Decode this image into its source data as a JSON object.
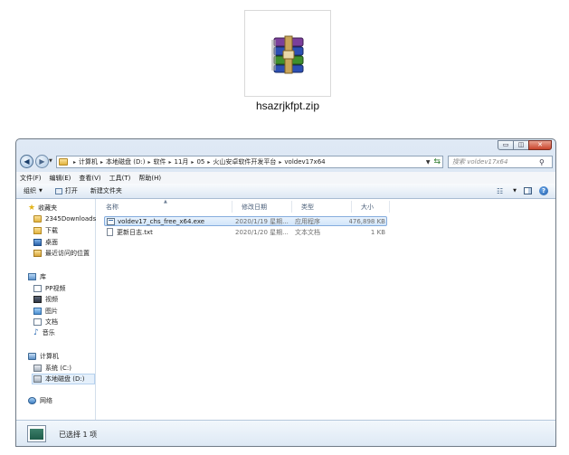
{
  "zip_file": {
    "name": "hsazrjkfpt.zip",
    "icon": "winrar-archive-icon"
  },
  "window": {
    "caption_buttons": {
      "minimize": "▭",
      "maximize": "◫",
      "close": "✕"
    },
    "breadcrumb": [
      "计算机",
      "本地磁盘 (D:)",
      "软件",
      "11月",
      "05",
      "火山安卓软件开发平台",
      "voldev17x64"
    ],
    "search_placeholder": "搜索 voldev17x64",
    "menu": [
      "文件(F)",
      "编辑(E)",
      "查看(V)",
      "工具(T)",
      "帮助(H)"
    ],
    "toolbar": {
      "organize": "组织",
      "open": "打开",
      "new_folder": "新建文件夹"
    },
    "nav": {
      "favorites": {
        "label": "收藏夹",
        "items": [
          "2345Downloads",
          "下载",
          "桌面",
          "最近访问的位置"
        ]
      },
      "libraries": {
        "label": "库",
        "items": [
          "PP视频",
          "视频",
          "图片",
          "文档",
          "音乐"
        ]
      },
      "computer": {
        "label": "计算机",
        "items": [
          "系统 (C:)",
          "本地磁盘 (D:)"
        ]
      },
      "network": {
        "label": "网络"
      }
    },
    "columns": {
      "name": "名称",
      "date": "修改日期",
      "type": "类型",
      "size": "大小"
    },
    "files": [
      {
        "name": "voldev17_chs_free_x64.exe",
        "date": "2020/1/19 星期...",
        "type": "应用程序",
        "size": "476,898 KB",
        "selected": true,
        "icon": "exe-file-icon"
      },
      {
        "name": "更新日志.txt",
        "date": "2020/1/20 星期...",
        "type": "文本文档",
        "size": "1 KB",
        "selected": false,
        "icon": "text-file-icon"
      }
    ],
    "status": "已选择 1 项"
  }
}
